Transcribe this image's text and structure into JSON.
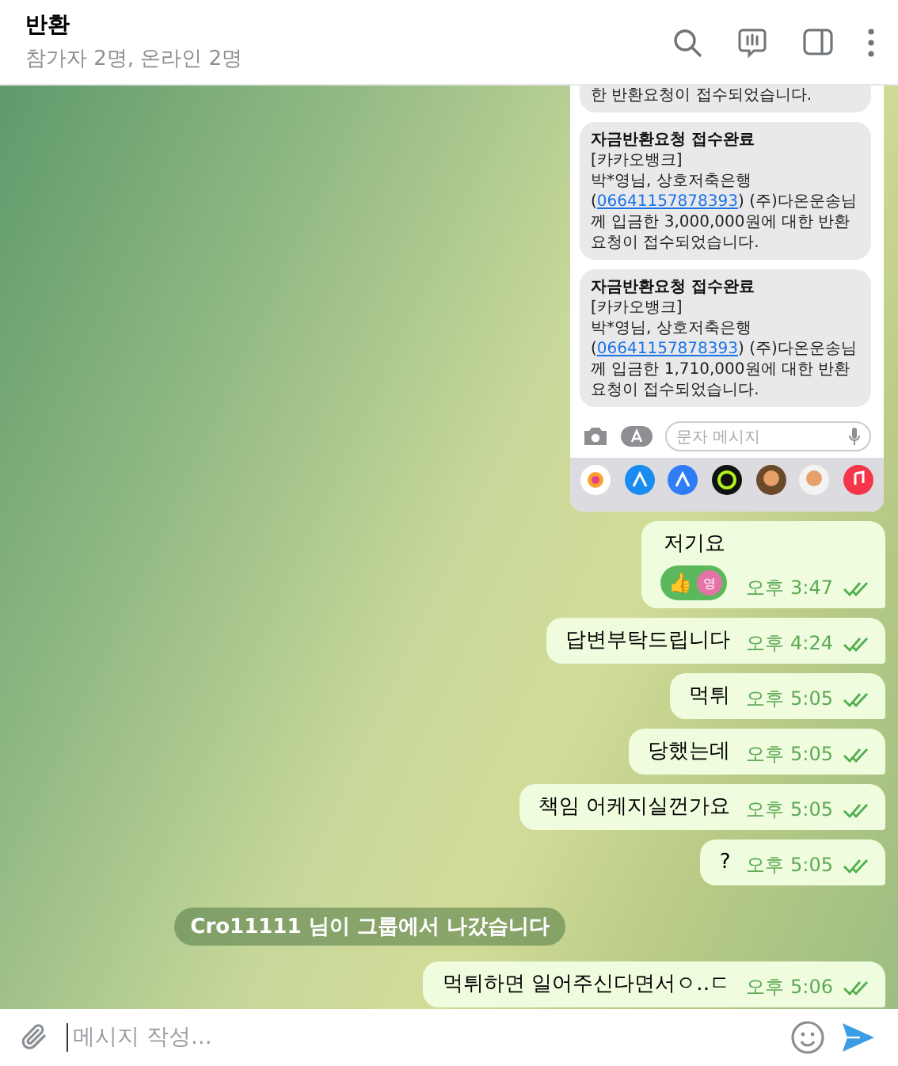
{
  "header": {
    "title": "반환",
    "subtitle": "참가자 2명, 온라인 2명"
  },
  "messages": [
    {
      "kind": "image",
      "screenshot": {
        "sms": [
          {
            "cut": true,
            "body_before": "한 반환요청이 접수되었습니다."
          },
          {
            "cut": false,
            "title": "자금반환요청 접수완료",
            "body_before": "[카카오뱅크]\n박*영님, 상호저축은행\n(",
            "link": "06641157878393",
            "body_after": ") (주)다온운송님께 입금한 3,000,000원에 대한 반환요청이 접수되었습니다."
          },
          {
            "cut": false,
            "title": "자금반환요청 접수완료",
            "body_before": "[카카오뱅크]\n박*영님, 상호저축은행\n(",
            "link": "06641157878393",
            "body_after": ") (주)다온운송님께 입금한 1,710,000원에 대한 반환요청이 접수되었습니다."
          }
        ],
        "input_placeholder": "문자 메시지"
      }
    },
    {
      "kind": "text",
      "text": "저기요",
      "time": "오후 3:47",
      "read": true,
      "reaction": {
        "emoji": "👍",
        "avatar": "영"
      }
    },
    {
      "kind": "text",
      "text": "답변부탁드립니다",
      "time": "오후 4:24",
      "read": true
    },
    {
      "kind": "text",
      "text": "먹튀",
      "time": "오후 5:05",
      "read": true
    },
    {
      "kind": "text",
      "text": "당했는데",
      "time": "오후 5:05",
      "read": true
    },
    {
      "kind": "text",
      "text": "책임 어케지실껀가요",
      "time": "오후 5:05",
      "read": true
    },
    {
      "kind": "text",
      "text": "?",
      "time": "오후 5:05",
      "read": true
    },
    {
      "kind": "service",
      "text": "Cro11111 님이 그룹에서 나갔습니다"
    },
    {
      "kind": "text",
      "text": "먹튀하면 일어주신다면서ㅇ‥ㄷ",
      "time": "오후 5:06",
      "read": true
    }
  ],
  "composer": {
    "placeholder": "메시지 작성..."
  }
}
